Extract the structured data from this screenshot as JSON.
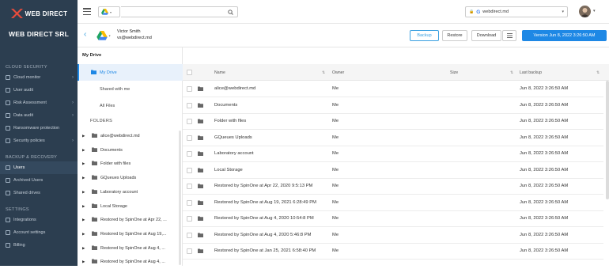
{
  "brand": {
    "logo_text": "WEB DIRECT",
    "company": "WEB DIRECT SRL"
  },
  "sidebar": {
    "sections": [
      {
        "title": "CLOUD SECURITY",
        "items": [
          {
            "label": "Cloud monitor",
            "icon": "cloud-icon",
            "has_chevron": true
          },
          {
            "label": "User audit",
            "icon": "user-icon"
          },
          {
            "label": "Risk Assessment",
            "icon": "risk-icon",
            "has_chevron": true
          },
          {
            "label": "Data audit",
            "icon": "data-audit-icon",
            "has_chevron": true
          },
          {
            "label": "Ransomware protection",
            "icon": "shield-icon"
          },
          {
            "label": "Security policies",
            "icon": "policy-icon",
            "has_chevron": true
          }
        ]
      },
      {
        "title": "BACKUP & RECOVERY",
        "items": [
          {
            "label": "Users",
            "icon": "users-icon",
            "active": true
          },
          {
            "label": "Archived Users",
            "icon": "archive-icon"
          },
          {
            "label": "Shared drives",
            "icon": "shared-drives-icon"
          }
        ]
      },
      {
        "title": "SETTINGS",
        "items": [
          {
            "label": "Integrations",
            "icon": "integrations-icon"
          },
          {
            "label": "Account settings",
            "icon": "gear-icon"
          },
          {
            "label": "Billing",
            "icon": "billing-icon"
          }
        ]
      }
    ]
  },
  "topbar": {
    "search_placeholder": "",
    "domain": "webdirect.md"
  },
  "userbar": {
    "name": "Victor Smith",
    "email": "vs@webdirect.md",
    "backup_label": "Backup",
    "restore_label": "Restore",
    "download_label": "Download",
    "version_label": "Version Jun 8, 2022 3:26:50 AM"
  },
  "tree": {
    "title": "My Drive",
    "nav": [
      {
        "label": "My Drive",
        "selected": true
      },
      {
        "label": "Shared with me"
      },
      {
        "label": "All Files"
      }
    ],
    "folders_title": "FOLDERS",
    "folders": [
      "alice@webdirect.md",
      "Documents",
      "Folder with files",
      "GQueues Uploads",
      "Laboratory account",
      "Local Storage",
      "Restored by SpinOne at Apr 22, ...",
      "Restored by SpinOne at Aug 19,...",
      "Restored by SpinOne at Aug 4, ...",
      "Restored by SpinOne at Aug 4, ..."
    ]
  },
  "table": {
    "columns": {
      "name": "Name",
      "owner": "Owner",
      "size": "Size",
      "last_backup": "Last backup"
    },
    "rows": [
      {
        "name": "alice@webdirect.md",
        "owner": "Me",
        "size": "",
        "last_backup": "Jun 8, 2022 3:26:50 AM"
      },
      {
        "name": "Documents",
        "owner": "Me",
        "size": "",
        "last_backup": "Jun 8, 2022 3:26:50 AM"
      },
      {
        "name": "Folder with files",
        "owner": "Me",
        "size": "",
        "last_backup": "Jun 8, 2022 3:26:50 AM"
      },
      {
        "name": "GQueues Uploads",
        "owner": "Me",
        "size": "",
        "last_backup": "Jun 8, 2022 3:26:50 AM"
      },
      {
        "name": "Laboratory account",
        "owner": "Me",
        "size": "",
        "last_backup": "Jun 8, 2022 3:26:50 AM"
      },
      {
        "name": "Local Storage",
        "owner": "Me",
        "size": "",
        "last_backup": "Jun 8, 2022 3:26:50 AM"
      },
      {
        "name": "Restored by SpinOne at Apr 22, 2020 9:5:13 PM",
        "owner": "Me",
        "size": "",
        "last_backup": "Jun 8, 2022 3:26:50 AM"
      },
      {
        "name": "Restored by SpinOne at Aug 19, 2021 6:28:49 PM",
        "owner": "Me",
        "size": "",
        "last_backup": "Jun 8, 2022 3:26:50 AM"
      },
      {
        "name": "Restored by SpinOne at Aug 4, 2020 10:54:8 PM",
        "owner": "Me",
        "size": "",
        "last_backup": "Jun 8, 2022 3:26:50 AM"
      },
      {
        "name": "Restored by SpinOne at Aug 4, 2020 5:46:8 PM",
        "owner": "Me",
        "size": "",
        "last_backup": "Jun 8, 2022 3:26:50 AM"
      },
      {
        "name": "Restored by SpinOne at Jan 25, 2021 6:58:40 PM",
        "owner": "Me",
        "size": "",
        "last_backup": "Jun 8, 2022 3:26:50 AM"
      }
    ]
  },
  "colors": {
    "sidebar_bg": "#2c3e50",
    "accent": "#1e88e5",
    "logo_red": "#e74c3c"
  }
}
